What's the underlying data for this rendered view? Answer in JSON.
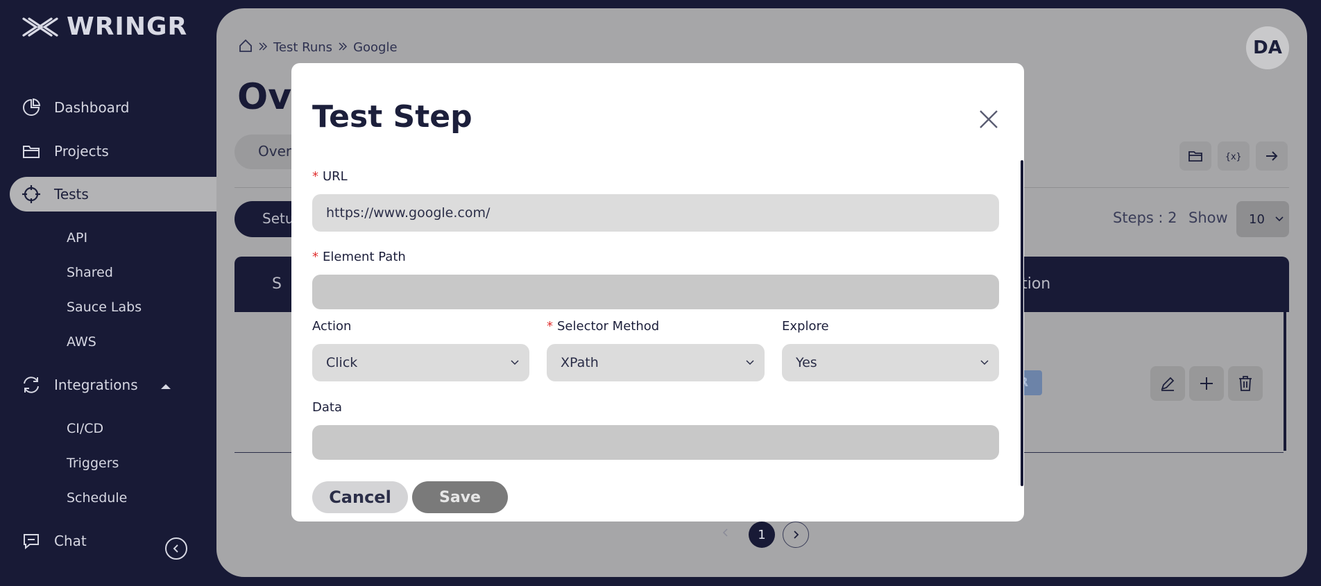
{
  "app": {
    "brand": "WRINGR"
  },
  "sidebar": {
    "items": [
      {
        "label": "Dashboard",
        "icon": "pie-chart-icon"
      },
      {
        "label": "Projects",
        "icon": "folder-icon"
      },
      {
        "label": "Tests",
        "icon": "crosshair-icon"
      },
      {
        "label": "Integrations",
        "icon": "refresh-icon"
      },
      {
        "label": "Chat",
        "icon": "chat-icon"
      }
    ],
    "tests_sub": [
      "API",
      "Shared",
      "Sauce Labs",
      "AWS"
    ],
    "integrations_sub": [
      "CI/CD",
      "Triggers",
      "Schedule"
    ]
  },
  "header": {
    "breadcrumb": [
      "Test Runs",
      "Google"
    ],
    "avatar": "DA",
    "title": "Ove",
    "tab_partial": "Over"
  },
  "toolbar": {
    "icons": [
      "folder-icon",
      "variable-icon",
      "arrow-right-icon"
    ]
  },
  "table": {
    "setup_partial": "Setu",
    "steps_count": "Steps : 2",
    "show_label": "Show",
    "show_value": "10",
    "head_partial_left": "S",
    "head_partial_right": "ction",
    "badge_partial": "EAR"
  },
  "pagination": {
    "current": "1"
  },
  "modal": {
    "title": "Test Step",
    "url_label": "URL",
    "url_value": "https://www.google.com/",
    "element_path_label": "Element Path",
    "element_path_value": "",
    "action_label": "Action",
    "action_value": "Click",
    "selector_label": "Selector Method",
    "selector_value": "XPath",
    "explore_label": "Explore",
    "explore_value": "Yes",
    "data_label": "Data",
    "data_value": "",
    "cancel": "Cancel",
    "save": "Save"
  }
}
